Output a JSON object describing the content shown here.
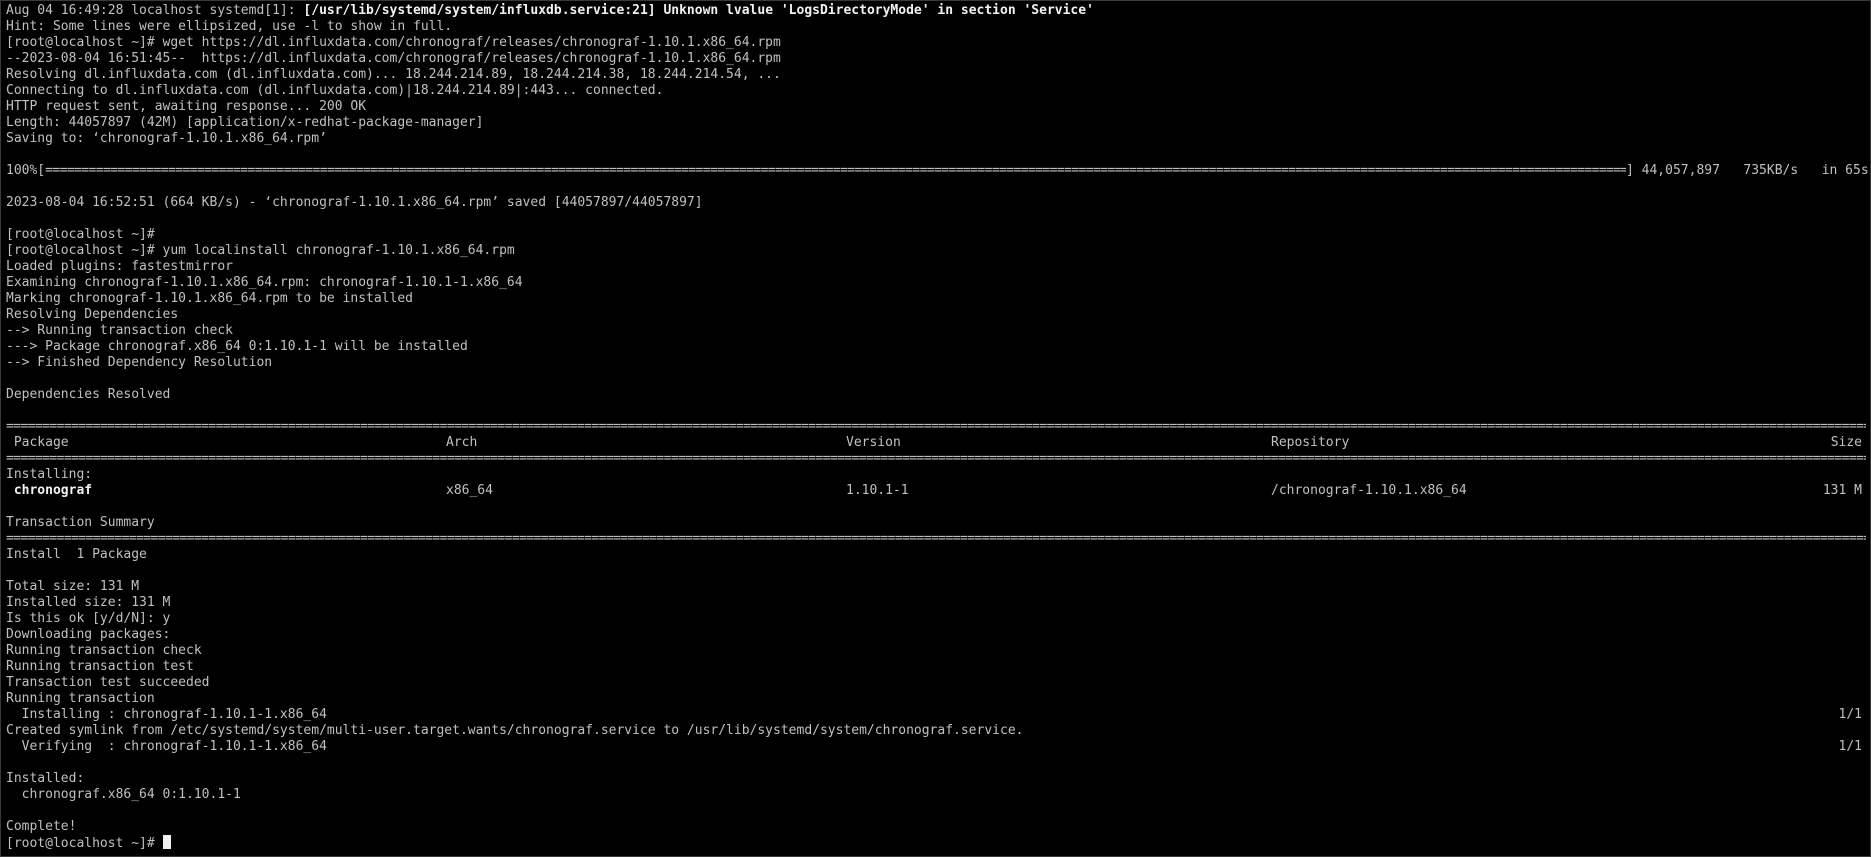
{
  "lines": {
    "l1_prefix": "Aug 04 16:49:28 localhost systemd[1]: ",
    "l1_bold": "[/usr/lib/systemd/system/influxdb.service:21] Unknown lvalue 'LogsDirectoryMode' in section 'Service'",
    "l2": "Hint: Some lines were ellipsized, use -l to show in full.",
    "l3": "[root@localhost ~]# wget https://dl.influxdata.com/chronograf/releases/chronograf-1.10.1.x86_64.rpm",
    "l4": "--2023-08-04 16:51:45--  https://dl.influxdata.com/chronograf/releases/chronograf-1.10.1.x86_64.rpm",
    "l5": "Resolving dl.influxdata.com (dl.influxdata.com)... 18.244.214.89, 18.244.214.38, 18.244.214.54, ...",
    "l6": "Connecting to dl.influxdata.com (dl.influxdata.com)|18.244.214.89|:443... connected.",
    "l7": "HTTP request sent, awaiting response... 200 OK",
    "l8": "Length: 44057897 (42M) [application/x-redhat-package-manager]",
    "l9": "Saving to: ‘chronograf-1.10.1.x86_64.rpm’",
    "l11": "2023-08-04 16:52:51 (664 KB/s) - ‘chronograf-1.10.1.x86_64.rpm’ saved [44057897/44057897]",
    "l13": "[root@localhost ~]#",
    "l14": "[root@localhost ~]# yum localinstall chronograf-1.10.1.x86_64.rpm",
    "l15": "Loaded plugins: fastestmirror",
    "l16": "Examining chronograf-1.10.1.x86_64.rpm: chronograf-1.10.1-1.x86_64",
    "l17": "Marking chronograf-1.10.1.x86_64.rpm to be installed",
    "l18": "Resolving Dependencies",
    "l19": "--> Running transaction check",
    "l20": "---> Package chronograf.x86_64 0:1.10.1-1 will be installed",
    "l21": "--> Finished Dependency Resolution",
    "l23": "Dependencies Resolved",
    "installing_label": "Installing:",
    "summary_label": "Transaction Summary",
    "install_count": "Install  1 Package",
    "total_size": "Total size: 131 M",
    "installed_size": "Installed size: 131 M",
    "confirm": "Is this ok [y/d/N]: y",
    "downloading": "Downloading packages:",
    "rtc": "Running transaction check",
    "rtt": "Running transaction test",
    "tts": "Transaction test succeeded",
    "rt": "Running transaction",
    "installing_step": "  Installing : chronograf-1.10.1-1.x86_64",
    "installing_count": "1/1",
    "symlink": "Created symlink from /etc/systemd/system/multi-user.target.wants/chronograf.service to /usr/lib/systemd/system/chronograf.service.",
    "verifying_step": "  Verifying  : chronograf-1.10.1-1.x86_64",
    "verifying_count": "1/1",
    "installed_label": "Installed:",
    "installed_pkg": "  chronograf.x86_64 0:1.10.1-1",
    "complete": "Complete!",
    "prompt": "[root@localhost ~]# "
  },
  "download": {
    "percent": "100%[",
    "progress": 1.0,
    "bytes": "] 44,057,897",
    "speed": "735KB/s",
    "eta": "in 65s"
  },
  "table": {
    "headers": {
      "package": " Package",
      "arch": "Arch",
      "version": "Version",
      "repository": "Repository",
      "size": "Size"
    },
    "row": {
      "package": " chronograf",
      "arch": "x86_64",
      "version": "1.10.1-1",
      "repository": "/chronograf-1.10.1.x86_64",
      "size": "131 M"
    }
  }
}
